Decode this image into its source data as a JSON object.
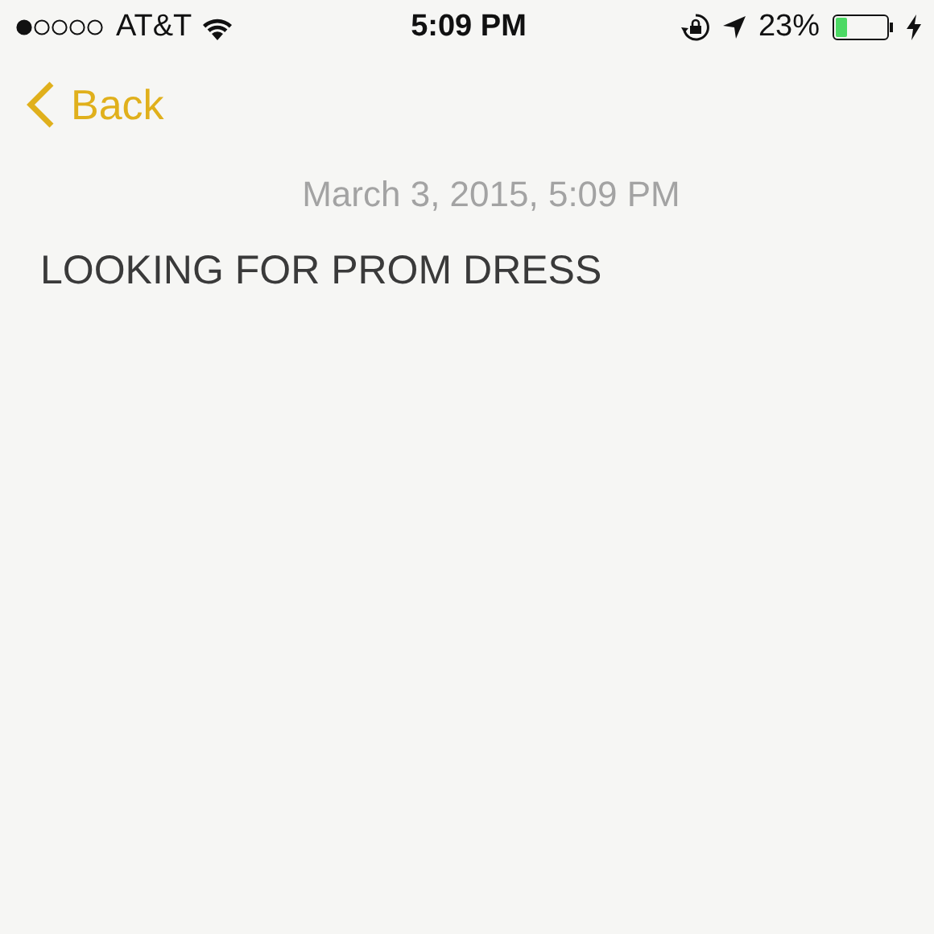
{
  "status_bar": {
    "carrier": "AT&T",
    "time": "5:09 PM",
    "battery": "23%"
  },
  "nav_bar": {
    "back": "Back"
  },
  "note": {
    "date": "March 3, 2015, 5:09 PM",
    "text": "LOOKING FOR PROM DRESS"
  }
}
